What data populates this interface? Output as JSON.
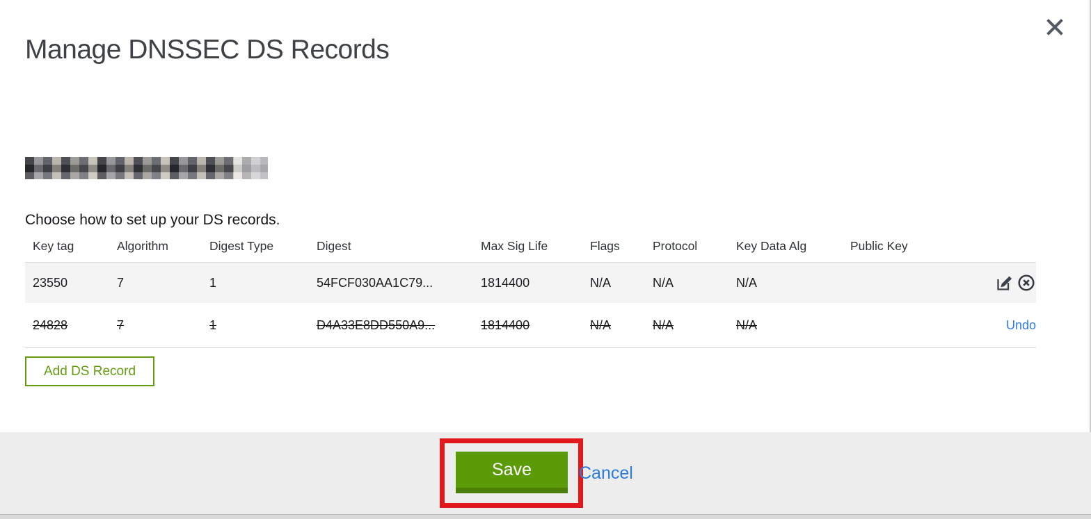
{
  "colors": {
    "accent_green": "#5e9b0b",
    "accent_green_dark": "#4a7e07",
    "link_blue": "#2e7cd6",
    "annotation_red": "#e2191c",
    "row_stripe": "#f4f4f4",
    "footer_bg": "#ededed"
  },
  "modal": {
    "title": "Manage DNSSEC DS Records",
    "domain_redacted": true,
    "instruction": "Choose how to set up your DS records.",
    "table": {
      "columns": [
        "Key tag",
        "Algorithm",
        "Digest Type",
        "Digest",
        "Max Sig Life",
        "Flags",
        "Protocol",
        "Key Data Alg",
        "Public Key"
      ],
      "rows": [
        {
          "key_tag": "23550",
          "algorithm": "7",
          "digest_type": "1",
          "digest": "54FCF030AA1C79...",
          "max_sig_life": "1814400",
          "flags": "N/A",
          "protocol": "N/A",
          "key_data_alg": "N/A",
          "public_key": "",
          "struck_through": false
        },
        {
          "key_tag": "24828",
          "algorithm": "7",
          "digest_type": "1",
          "digest": "D4A33E8DD550A9...",
          "max_sig_life": "1814400",
          "flags": "N/A",
          "protocol": "N/A",
          "key_data_alg": "N/A",
          "public_key": "",
          "struck_through": true,
          "undo_label": "Undo"
        }
      ]
    },
    "add_button_label": "Add DS Record",
    "footer": {
      "save_label": "Save",
      "cancel_label": "Cancel"
    },
    "icons": {
      "close": "x-mark",
      "edit": "pencil-square",
      "delete": "circle-x"
    }
  }
}
